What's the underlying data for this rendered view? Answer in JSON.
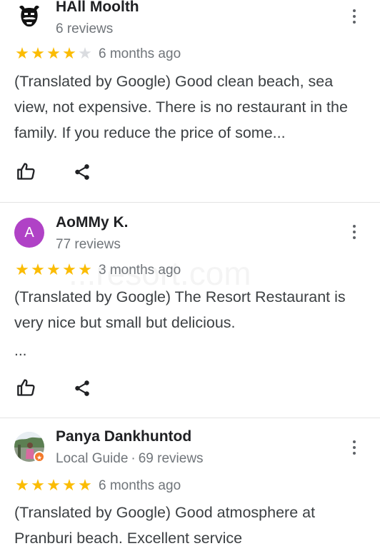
{
  "reviews": [
    {
      "name": "HAll Moolth",
      "subtitle": "6 reviews",
      "rating": 4,
      "time": "6 months ago",
      "text": "(Translated by Google) Good clean beach, sea view, not expensive. There is no restaurant in the family. If you reduce the price of some...",
      "avatar": "mustache-face-icon"
    },
    {
      "name": "AoMMy K.",
      "subtitle": "77 reviews",
      "rating": 5,
      "time": "3 months ago",
      "text": "(Translated by Google) The Resort Restaurant is very nice but small but delicious.",
      "more": "...",
      "avatar_letter": "A",
      "avatar_color": "#b042c6"
    },
    {
      "name": "Panya Dankhuntod",
      "badge": "Local Guide",
      "subtitle": "69 reviews",
      "rating": 5,
      "time": "6 months ago",
      "text": "(Translated by Google) Good atmosphere at Pranburi beach. Excellent service",
      "avatar": "photo-avatar",
      "guide_badge_color": "#f3792b"
    }
  ],
  "watermark": "...resort.com",
  "colors": {
    "star": "#fbbc04",
    "star_empty": "#dadce0",
    "muted": "#70757a"
  }
}
